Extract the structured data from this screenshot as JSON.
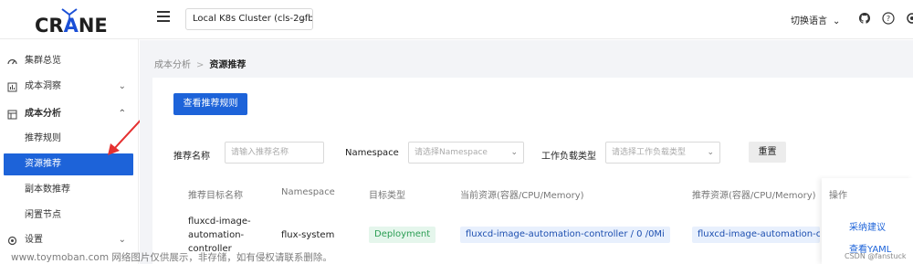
{
  "header": {
    "logo_prefix": "CR",
    "logo_a": "A",
    "logo_suffix": "NE",
    "cluster": "Local K8s Cluster (cls-2gfb",
    "language": "切换语言"
  },
  "sidebar": {
    "items": [
      {
        "label": "集群总览"
      },
      {
        "label": "成本洞察"
      },
      {
        "label": "成本分析"
      },
      {
        "label": "推荐规则"
      },
      {
        "label": "资源推荐"
      },
      {
        "label": "副本数推荐"
      },
      {
        "label": "闲置节点"
      },
      {
        "label": "设置"
      }
    ]
  },
  "breadcrumb": {
    "parent": "成本分析",
    "sep": ">",
    "current": "资源推荐"
  },
  "main": {
    "view_rules_button": "查看推荐规则"
  },
  "filters": {
    "name_label": "推荐名称",
    "name_placeholder": "请输入推荐名称",
    "namespace_label": "Namespace",
    "namespace_placeholder": "请选择Namespace",
    "workload_label": "工作负载类型",
    "workload_placeholder": "请选择工作负载类型",
    "reset_button": "重置"
  },
  "table": {
    "headers": [
      "推荐目标名称",
      "Namespace",
      "目标类型",
      "当前资源(容器/CPU/Memory)",
      "推荐资源(容器/CPU/Memory)",
      "操作"
    ],
    "row": {
      "name_line1": "fluxcd-image-",
      "name_line2": "automation-",
      "name_line3": "controller",
      "namespace": "flux-system",
      "type": "Deployment",
      "current": "fluxcd-image-automation-controller / 0 /0Mi",
      "recommended": "fluxcd-image-automation-c",
      "action_adopt": "采纳建议",
      "action_yaml": "查看YAML"
    }
  },
  "watermark": {
    "text": "www.toymoban.com 网络图片仅供展示，非存储，如有侵权请联系删除。",
    "csdn": "CSDN @fanstuck"
  },
  "colors": {
    "accent": "#1d63d9",
    "tag_green_bg": "#e5f6ec",
    "tag_blue_bg": "#e8f0fd",
    "annotation_arrow": "#e53030"
  }
}
